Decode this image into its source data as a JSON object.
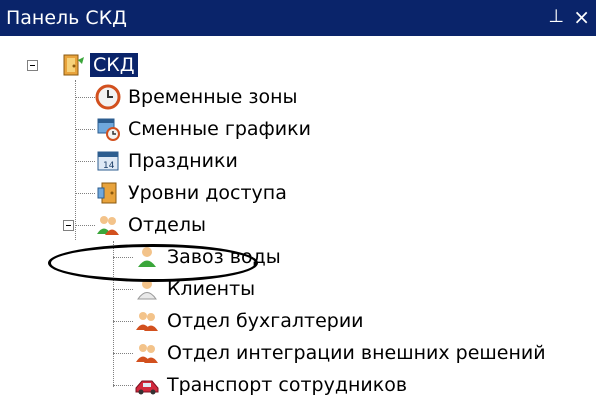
{
  "panel": {
    "title": "Панель СКД",
    "pin_glyph": "⊥",
    "close_glyph": "×"
  },
  "tree": {
    "root": {
      "label": "СКД",
      "icon": "skd-root-icon",
      "selected": true,
      "expanded": true
    },
    "items": [
      {
        "label": "Временные зоны",
        "icon": "clock-icon"
      },
      {
        "label": "Сменные графики",
        "icon": "shift-schedule-icon"
      },
      {
        "label": "Праздники",
        "icon": "calendar-icon"
      },
      {
        "label": "Уровни доступа",
        "icon": "access-door-icon"
      },
      {
        "label": "Отделы",
        "icon": "departments-icon",
        "expanded": true
      }
    ],
    "departments": [
      {
        "label": "Завоз воды",
        "icon": "user-green-icon"
      },
      {
        "label": "Клиенты",
        "icon": "user-icon"
      },
      {
        "label": "Отдел бухгалтерии",
        "icon": "users-group-icon"
      },
      {
        "label": "Отдел интеграции внешних решений",
        "icon": "users-group-icon"
      },
      {
        "label": "Транспорт сотрудников",
        "icon": "vehicle-icon"
      }
    ]
  },
  "colors": {
    "titlebar": "#0a246a",
    "selection": "#0a246a"
  }
}
